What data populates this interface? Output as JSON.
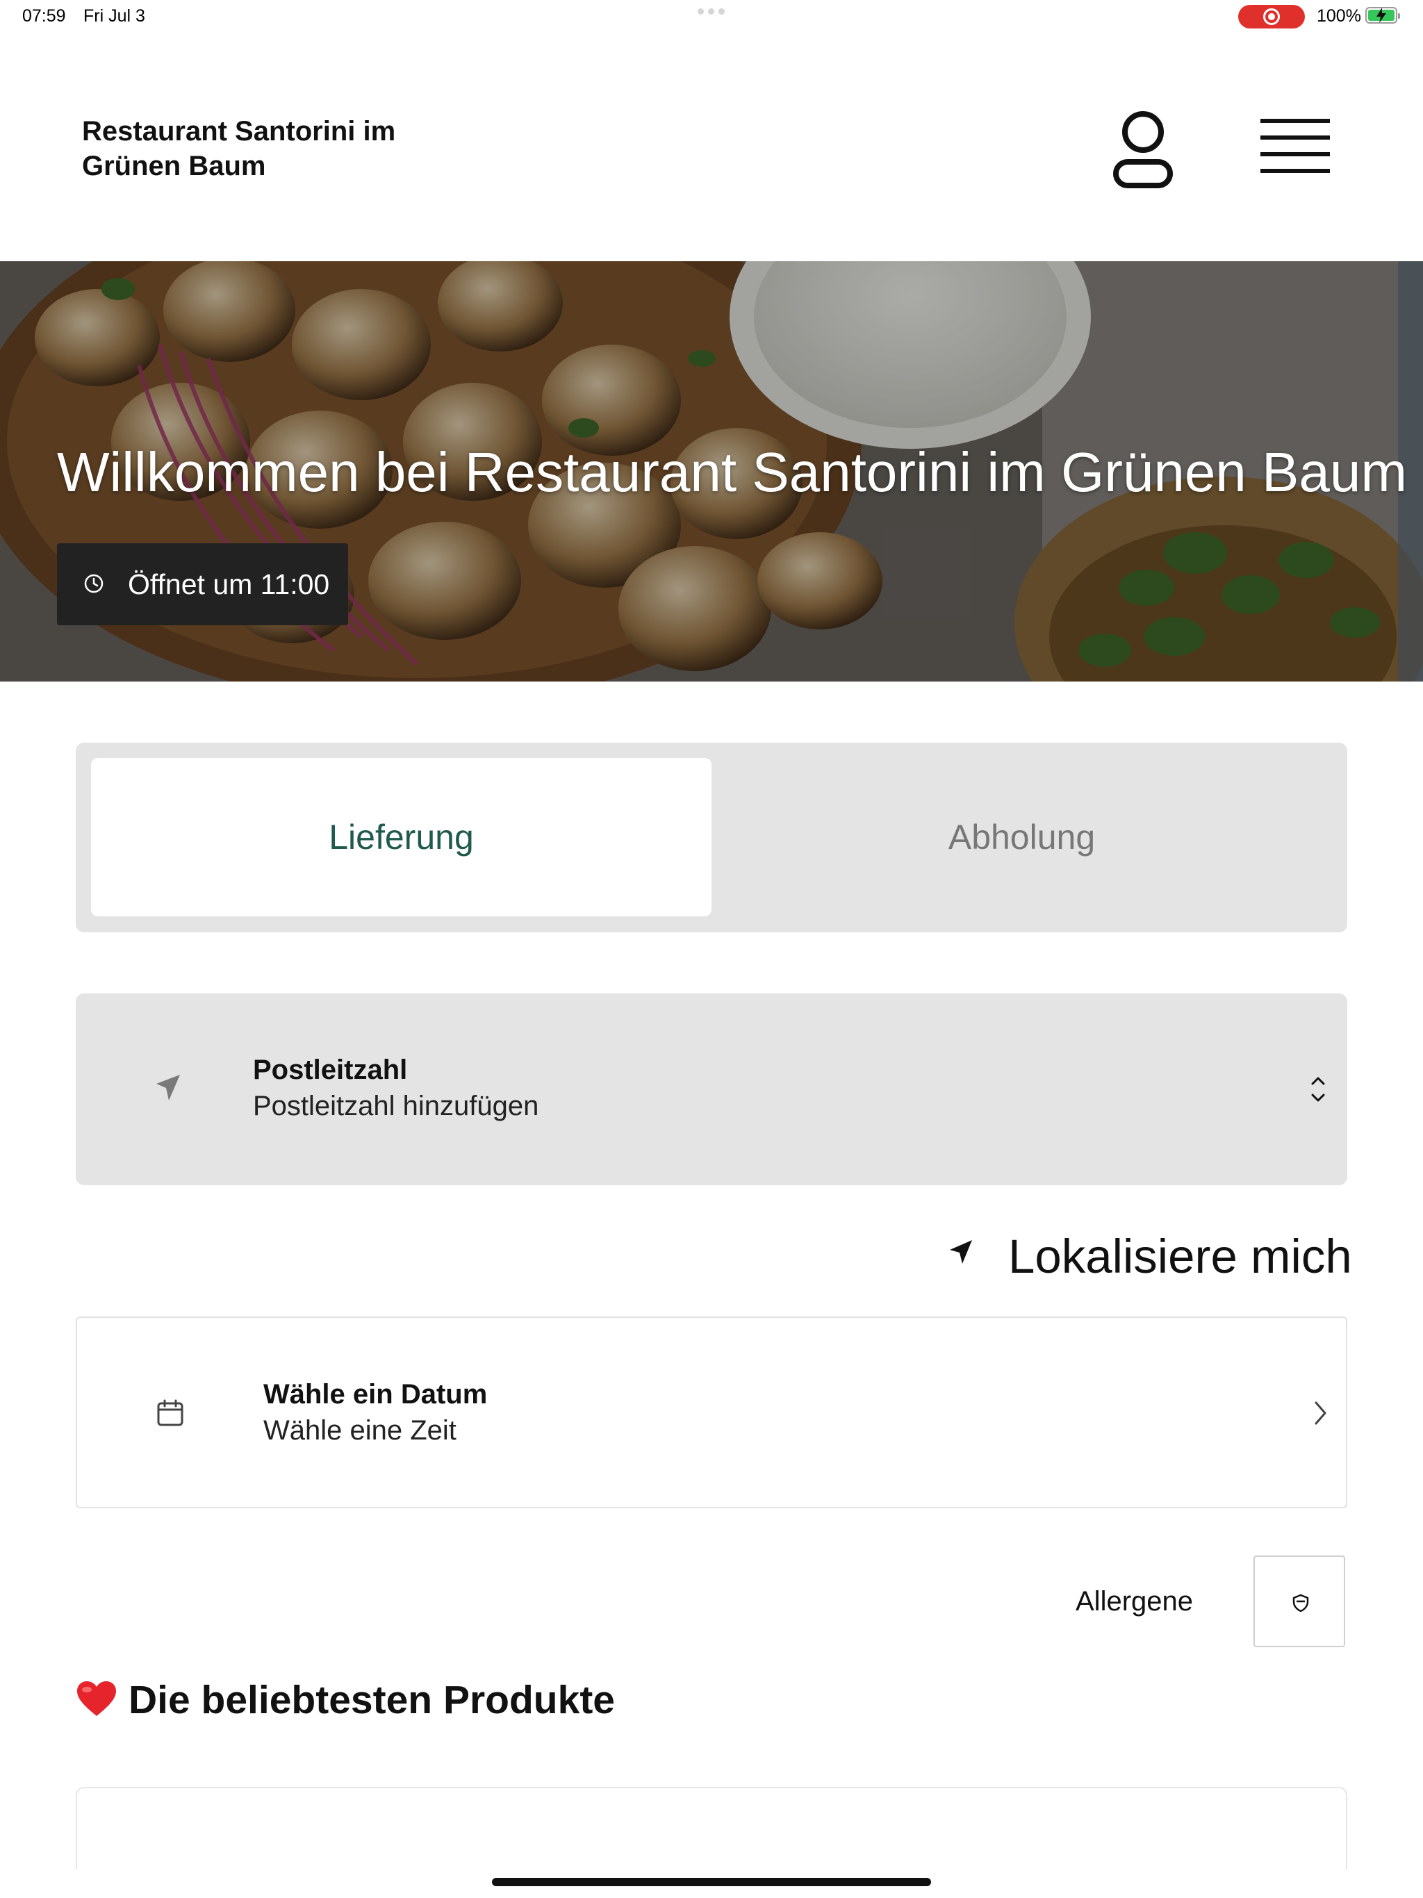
{
  "status_bar": {
    "time": "07:59",
    "date": "Fri Jul 3",
    "battery_percent": "100%",
    "recording_active": true,
    "charging": true
  },
  "header": {
    "restaurant_name": "Restaurant Santorini im Grünen Baum",
    "icons": {
      "account": "user-icon",
      "menu": "hamburger-menu-icon"
    }
  },
  "hero": {
    "title": "Willkommen bei Restaurant Santorini im Grünen Baum",
    "opening_status": "Öffnet um 11:00",
    "image_subject": "grilled chicken souvlaki with tzatziki, red onion and oregano"
  },
  "order_mode": {
    "tabs": [
      {
        "label": "Lieferung",
        "selected": true
      },
      {
        "label": "Abholung",
        "selected": false
      }
    ],
    "active_color": "#1f5a4d"
  },
  "postal_code": {
    "title": "Postleitzahl",
    "placeholder": "Postleitzahl hinzufügen"
  },
  "locate": {
    "label": "Lokalisiere mich"
  },
  "schedule": {
    "title": "Wähle ein Datum",
    "subtitle": "Wähle eine Zeit"
  },
  "allergens": {
    "label": "Allergene"
  },
  "popular": {
    "emoji": "❤️",
    "title": "Die beliebtesten Produkte"
  },
  "colors": {
    "accent": "#1f5a4d",
    "panel": "#e4e4e4",
    "hours_badge": "#222222",
    "recording": "#e0302c",
    "battery": "#35c759"
  }
}
